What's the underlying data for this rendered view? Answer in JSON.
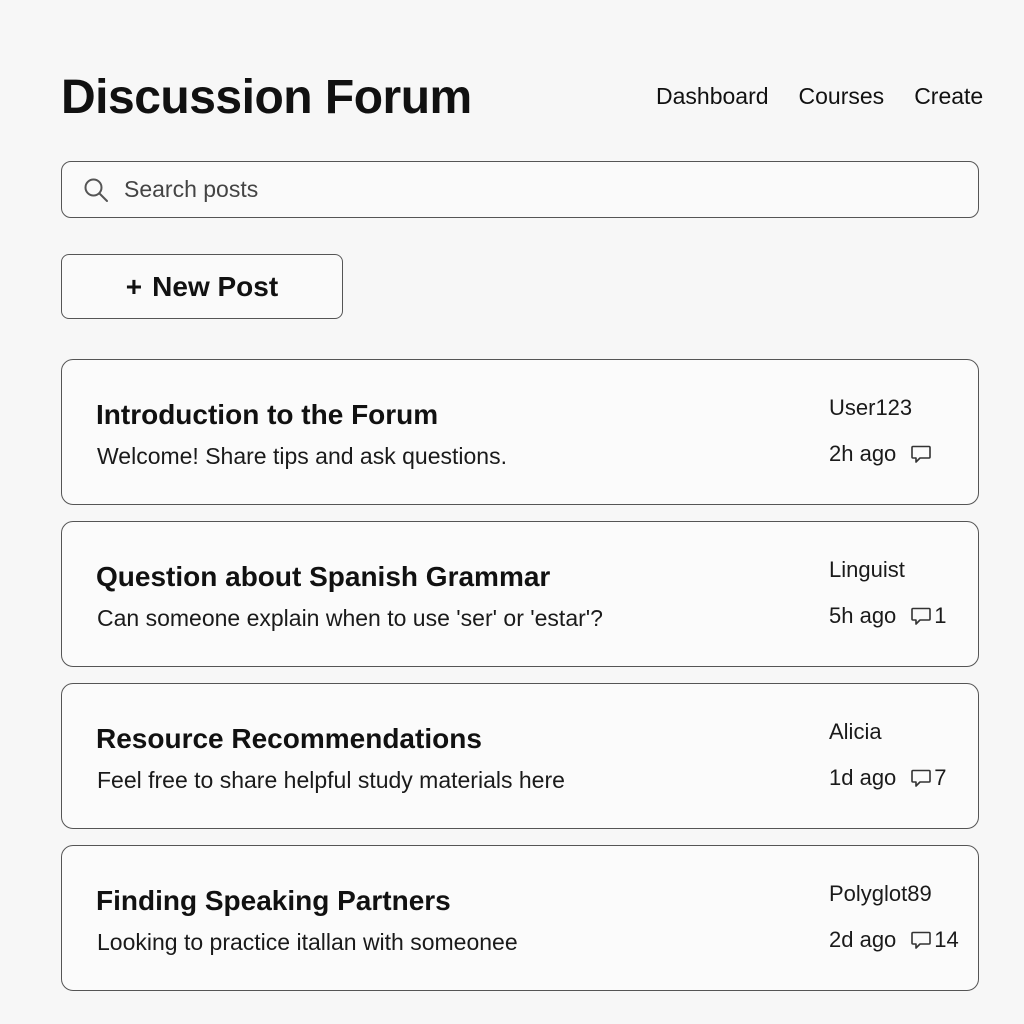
{
  "header": {
    "title": "Discussion Forum",
    "nav": [
      "Dashboard",
      "Courses",
      "Create"
    ]
  },
  "search": {
    "placeholder": "Search posts",
    "value": "",
    "icon": "search-icon"
  },
  "actions": {
    "new_post_plus": "+",
    "new_post_label": "New Post"
  },
  "posts": [
    {
      "title": "Introduction to the Forum",
      "excerpt": "Welcome! Share tips and ask questions.",
      "author": "User123",
      "time": "2h ago",
      "comments": ""
    },
    {
      "title": "Question about Spanish Grammar",
      "excerpt": "Can someone explain when to use 'ser' or 'estar'?",
      "author": "Linguist",
      "time": "5h ago",
      "comments": "1"
    },
    {
      "title": "Resource Recommendations",
      "excerpt": "Feel free to share helpful study materials here",
      "author": "Alicia",
      "time": "1d ago",
      "comments": "7"
    },
    {
      "title": "Finding Speaking Partners",
      "excerpt": "Looking to practice itallan with someonee",
      "author": "Polyglot89",
      "time": "2d ago",
      "comments": "14"
    }
  ],
  "colors": {
    "background": "#f7f7f7",
    "border": "#555555",
    "text": "#111111"
  }
}
